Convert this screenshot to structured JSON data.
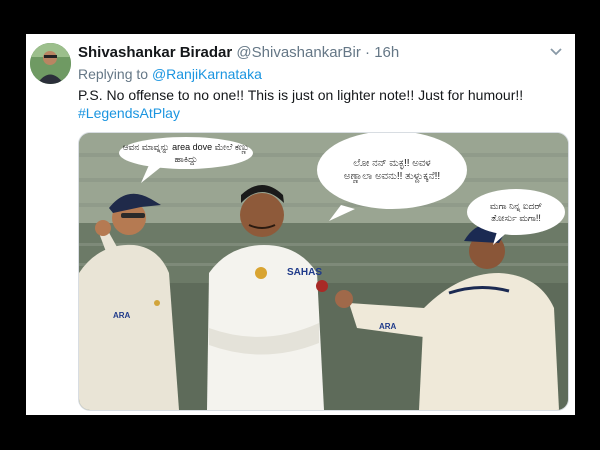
{
  "tweet": {
    "display_name": "Shivashankar Biradar",
    "handle": "@ShivashankarBir",
    "separator": "·",
    "timestamp": "16h",
    "replying_prefix": "Replying to",
    "reply_to": "@RanjiKarnataka",
    "text": "P.S. No offense to no one!! This is just on lighter note!! Just for humour!!",
    "hashtag": "#LegendsAtPlay"
  },
  "media": {
    "bubble_left": "ಆವನ ಮಾವ್ನನ್ನು area dove ಮೇಲೆ ಕಣ್ಣು ಹಾಕಿದ್ದು",
    "bubble_center": "ಲೋ ನನ್ ಮಕ್ಳ!! ಅವಳ ಅಣ್ಣಾಲಾ ಅವನು!! ತುಳ್ದುಕ್ಕನೆ!!",
    "bubble_right": "ಮಗಾ ನಿನ್ನ ಐದರ್ ತೋರ್ಸು ಮಗಾ!!",
    "shirt_text_center": "SAHAS",
    "shirt_text_left": "ARA",
    "shirt_text_right": "ARA"
  },
  "colors": {
    "link": "#1b95e0",
    "muted": "#657786",
    "text": "#14171a"
  },
  "icons": [
    "avatar",
    "chevron-down-icon"
  ]
}
